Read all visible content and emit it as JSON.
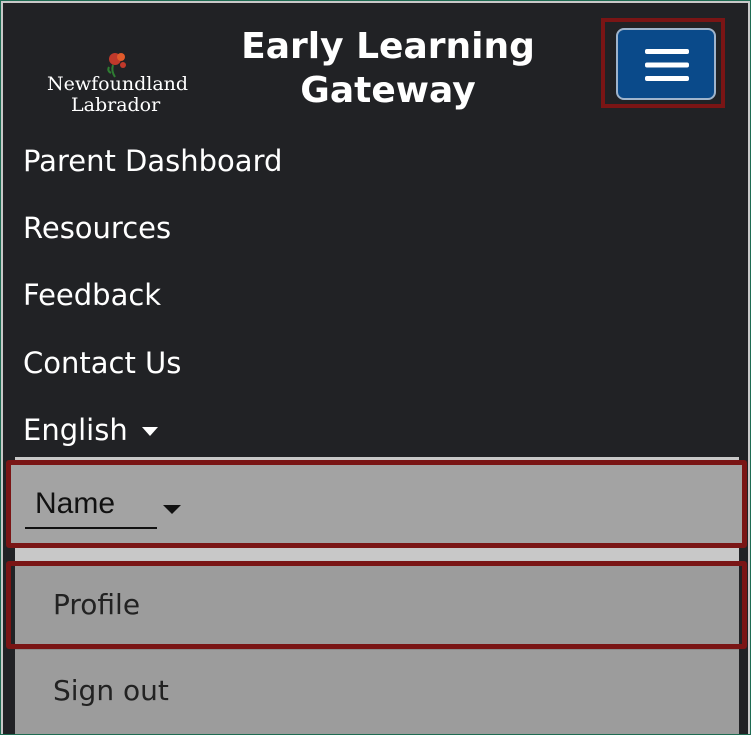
{
  "header": {
    "logo_line1": "Newfoundland",
    "logo_line2": "Labrador",
    "title": "Early Learning Gateway",
    "menu_icon": "hamburger-icon"
  },
  "nav": {
    "items": [
      {
        "label": "Parent Dashboard"
      },
      {
        "label": "Resources"
      },
      {
        "label": "Feedback"
      },
      {
        "label": "Contact Us"
      },
      {
        "label": "English"
      }
    ]
  },
  "account": {
    "name_label": "Name",
    "menu": [
      {
        "label": "Profile"
      },
      {
        "label": "Sign out"
      }
    ]
  },
  "colors": {
    "nav_bg": "#212225",
    "menu_button_bg": "#0a4a8a",
    "highlight_border": "#7a1515",
    "dropdown_bg": "#9c9c9c"
  }
}
